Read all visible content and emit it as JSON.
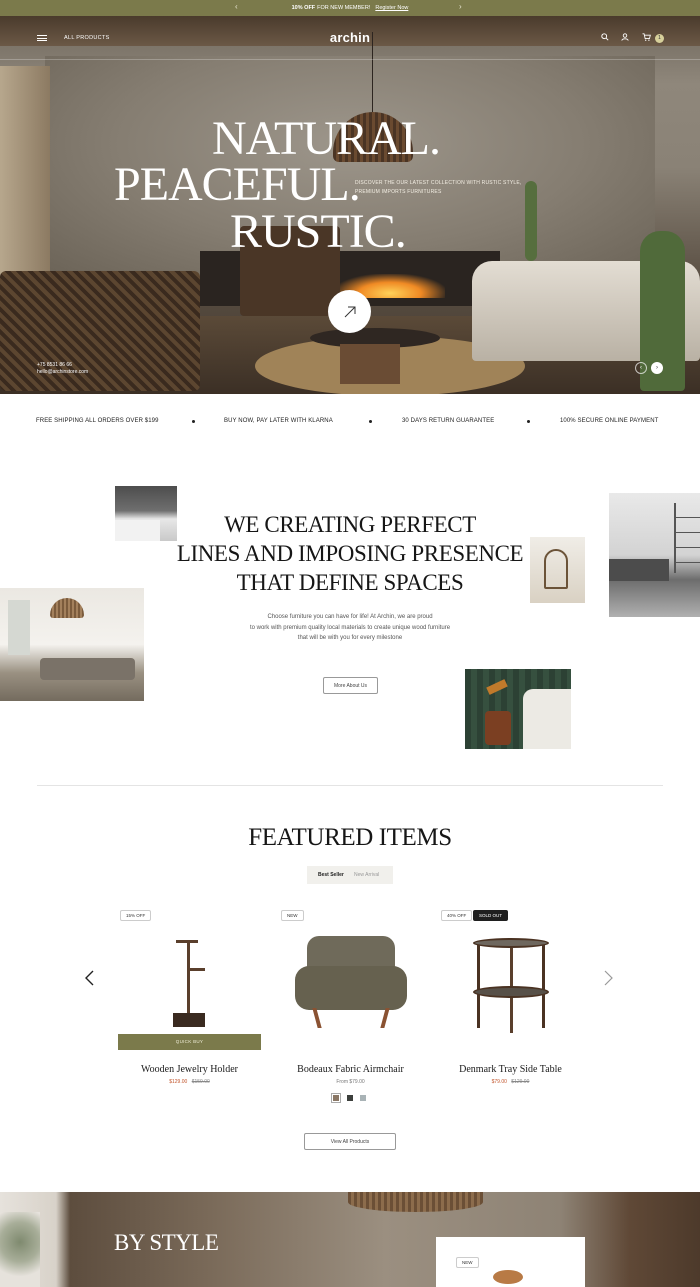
{
  "announcement": {
    "bold": "10% OFF",
    "text": "FOR NEW MEMBER!",
    "link": "Register Now",
    "prev": "‹",
    "next": "›"
  },
  "nav": {
    "menu_label": "ALL PRODUCTS",
    "logo": "archin",
    "icons": [
      "search-icon",
      "user-icon",
      "cart-icon"
    ],
    "cart_count": "1"
  },
  "hero": {
    "line1": "NATURAL.",
    "line2": "PEACEFUL.",
    "line3": "RUSTIC.",
    "subtitle": "DISCOVER THE OUR LATEST COLLECTION WITH RUSTIC STYLE, PREMIUM IMPORTS FURNITURES",
    "phone": "+75 8531 86 66",
    "email": "hello@archinstore.com",
    "cta_icon": "arrow-up-right-icon"
  },
  "benefits": [
    "FREE SHIPPING ALL ORDERS OVER $199",
    "BUY NOW, PAY LATER WITH KLARNA",
    "30 DAYS RETURN GUARANTEE",
    "100% SECURE ONLINE PAYMENT"
  ],
  "about": {
    "title_1": "WE CREATING PERFECT",
    "title_2": "LINES AND IMPOSING PRESENCE",
    "title_3": "THAT DEFINE SPACES",
    "text_1": "Choose furniture you can have for life! At Archin, we are proud",
    "text_2": "to work with premium quality local materials to create unique wood furniture",
    "text_3": "that will be with you for every milestone",
    "button": "More About Us"
  },
  "featured": {
    "title": "FEATURED ITEMS",
    "tabs": [
      "Best Seller",
      "New Arrival"
    ],
    "products": [
      {
        "name": "Wooden Jewelry Holder",
        "badges": [
          "15% OFF"
        ],
        "sale_price": "$129.00",
        "old_price": "$159.00",
        "quick_buy": "QUICK BUY"
      },
      {
        "name": "Bodeaux Fabric Airmchair",
        "badges": [
          "NEW"
        ],
        "price": "From $79.00"
      },
      {
        "name": "Denmark Tray Side Table",
        "badges": [
          "40% OFF",
          "SOLD OUT"
        ],
        "sale_price": "$79.00",
        "old_price": "$129.00"
      }
    ],
    "swatch_colors": [
      "#8a7765",
      "#3c3f3c",
      "#a9b3b6"
    ],
    "view_all": "View All Products"
  },
  "by_style": {
    "title": "BY STYLE",
    "card_badge": "NEW"
  },
  "colors": {
    "accent": "#7b7a4b",
    "sale": "#c2552c"
  }
}
